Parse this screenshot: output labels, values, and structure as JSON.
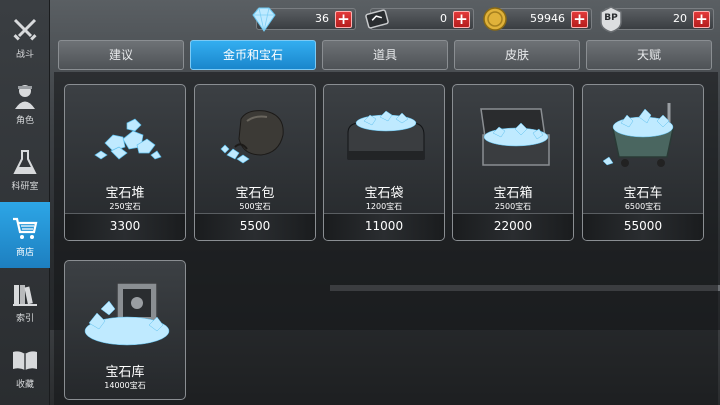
{
  "sidebar": {
    "items": [
      {
        "label": "战斗",
        "icon": "crossed-swords-icon"
      },
      {
        "label": "角色",
        "icon": "soldier-icon"
      },
      {
        "label": "科研室",
        "icon": "flask-icon"
      },
      {
        "label": "商店",
        "icon": "cart-icon",
        "active": true
      },
      {
        "label": "索引",
        "icon": "books-icon"
      },
      {
        "label": "收藏",
        "icon": "open-book-icon"
      }
    ]
  },
  "resources": [
    {
      "name": "diamonds",
      "icon": "diamond-icon",
      "value": "36"
    },
    {
      "name": "cards",
      "icon": "card-icon",
      "value": "0"
    },
    {
      "name": "coins",
      "icon": "coin-icon",
      "value": "59946"
    },
    {
      "name": "bp",
      "icon": "bp-badge-icon",
      "badge_text": "BP",
      "value": "20"
    }
  ],
  "plus_label": "+",
  "tabs": [
    {
      "label": "建议"
    },
    {
      "label": "金币和宝石",
      "active": true
    },
    {
      "label": "道具"
    },
    {
      "label": "皮肤"
    },
    {
      "label": "天赋"
    }
  ],
  "products": [
    {
      "name": "宝石堆",
      "sub": "250宝石",
      "price": "3300",
      "art": "gem-pile"
    },
    {
      "name": "宝石包",
      "sub": "500宝石",
      "price": "5500",
      "art": "gem-bag"
    },
    {
      "name": "宝石袋",
      "sub": "1200宝石",
      "price": "11000",
      "art": "gem-duffel"
    },
    {
      "name": "宝石箱",
      "sub": "2500宝石",
      "price": "22000",
      "art": "gem-case"
    },
    {
      "name": "宝石车",
      "sub": "6500宝石",
      "price": "55000",
      "art": "gem-cart"
    },
    {
      "name": "宝石库",
      "sub": "14000宝石",
      "price": "",
      "art": "gem-vault"
    }
  ],
  "colors": {
    "accent": "#2da6e6",
    "plus_red": "#d42a2a",
    "gem_blue": "#a9e4ff"
  }
}
